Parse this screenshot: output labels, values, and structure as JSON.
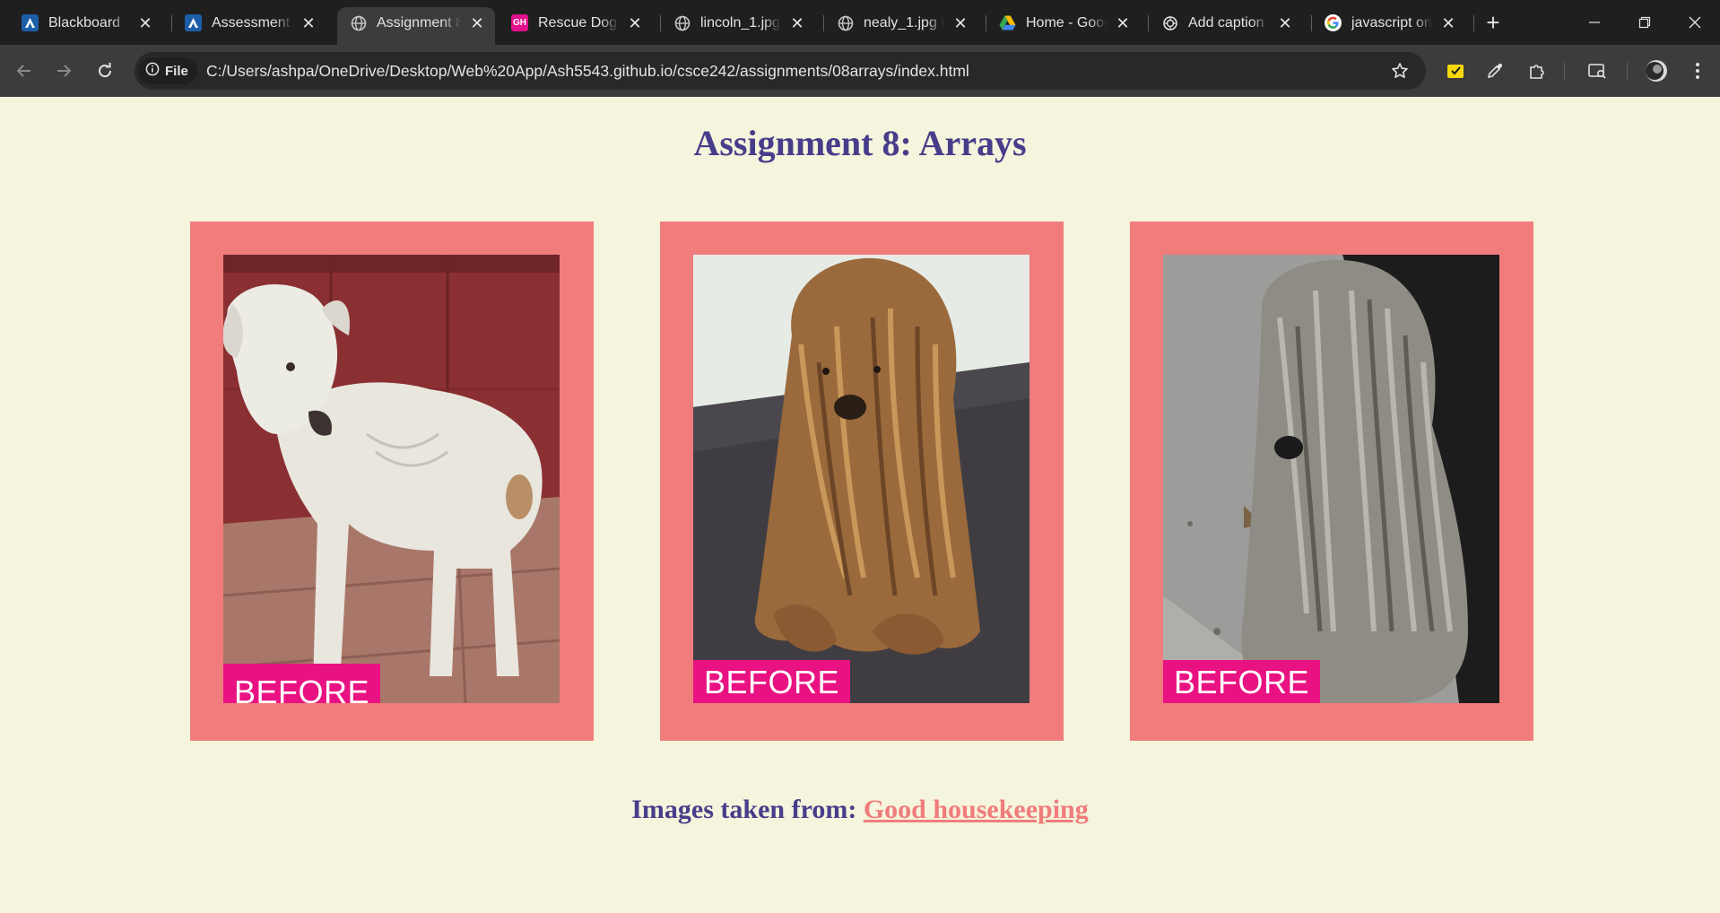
{
  "browser": {
    "tabs": [
      {
        "title": "Blackboard",
        "icon": "blackboard-icon",
        "active": false
      },
      {
        "title": "Assessment Fe",
        "icon": "blackboard-icon",
        "active": false
      },
      {
        "title": "Assignment 8",
        "icon": "globe-icon",
        "active": true
      },
      {
        "title": "Rescue Dogs B",
        "icon": "gh-icon",
        "favicon_text": "GH",
        "active": false
      },
      {
        "title": "lincoln_1.jpg (",
        "icon": "globe-icon",
        "active": false
      },
      {
        "title": "nealy_1.jpg (7",
        "icon": "globe-icon",
        "active": false
      },
      {
        "title": "Home - Googl",
        "icon": "google-drive-icon",
        "active": false
      },
      {
        "title": "Add caption t",
        "icon": "openai-icon",
        "active": false
      },
      {
        "title": "javascript on t",
        "icon": "google-icon",
        "active": false
      }
    ],
    "new_tab_label": "+",
    "address": {
      "scheme_chip": "File",
      "url": "C:/Users/ashpa/OneDrive/Desktop/Web%20App/Ash5543.github.io/csce242/assignments/08arrays/index.html"
    }
  },
  "page": {
    "title": "Assignment 8: Arrays",
    "cards": [
      {
        "badge": "BEFORE",
        "alt": "white boxer dog"
      },
      {
        "badge": "BEFORE",
        "alt": "matted brown dog"
      },
      {
        "badge": "BEFORE",
        "alt": "matted grey dog"
      }
    ],
    "caption_prefix": "Images taken from: ",
    "caption_link": "Good housekeeping"
  },
  "colors": {
    "background": "#f5f4dc",
    "heading": "#483d8b",
    "card": "#f07c7c",
    "badge": "#e91282"
  }
}
